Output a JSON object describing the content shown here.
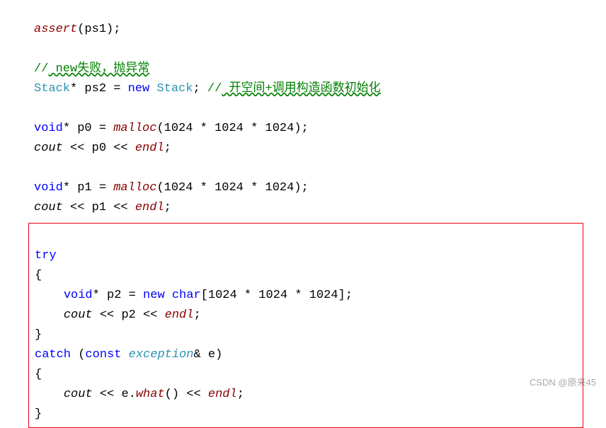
{
  "code": {
    "assert": "assert",
    "ps1": "ps1",
    "semicolon": ";",
    "lparen": "(",
    "rparen": ")",
    "lbrace": "{",
    "rbrace": "}",
    "lbracket": "[",
    "rbracket": "]",
    "star": "*",
    "eq": "=",
    "lshift": "<<",
    "amp": "&",
    "dot": ".",
    "comment1_slashes": "//",
    "comment1_text": " new失败，抛异常",
    "Stack": "Stack",
    "ps2": "ps2",
    "new": "new",
    "comment2_slashes": "//",
    "comment2_text": " 开空间+调用构造函数初始化",
    "void": "void",
    "p0": "p0",
    "p1": "p1",
    "p2": "p2",
    "malloc": "malloc",
    "n1024": "1024",
    "cout": "cout",
    "endl": "endl",
    "try": "try",
    "char": "char",
    "catch": "catch",
    "const": "const",
    "exception": "exception",
    "e": "e",
    "what": "what"
  },
  "watermark": "CSDN @原来45"
}
